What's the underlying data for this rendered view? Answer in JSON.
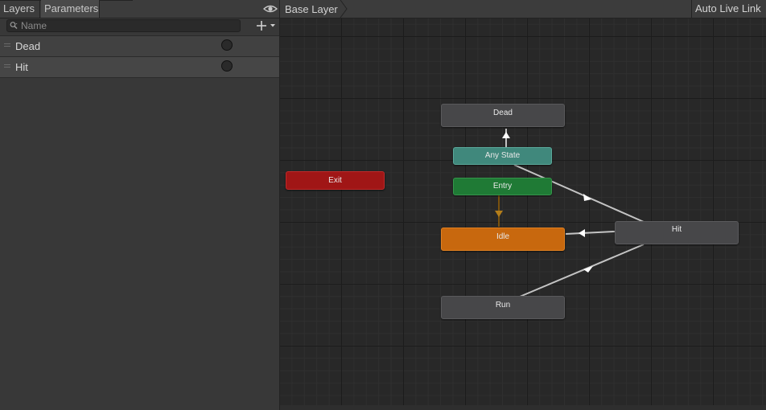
{
  "left_panel": {
    "tabs": {
      "layers": "Layers",
      "parameters": "Parameters"
    },
    "search": {
      "placeholder": "Name",
      "value": ""
    },
    "parameters": [
      {
        "name": "Dead",
        "type": "trigger"
      },
      {
        "name": "Hit",
        "type": "trigger"
      }
    ]
  },
  "graph": {
    "breadcrumb": "Base Layer",
    "auto_live_link": "Auto Live Link",
    "states": {
      "dead": "Dead",
      "any_state": "Any State",
      "entry": "Entry",
      "exit": "Exit",
      "idle": "Idle",
      "hit": "Hit",
      "run": "Run"
    },
    "colors": {
      "default_state": "#474749",
      "any_state": "#40887c",
      "entry": "#1f7a35",
      "exit": "#a01616",
      "default_layer_state": "#c8680e",
      "transition": "#c4c4c4",
      "default_transition": "#8a5a10"
    }
  }
}
